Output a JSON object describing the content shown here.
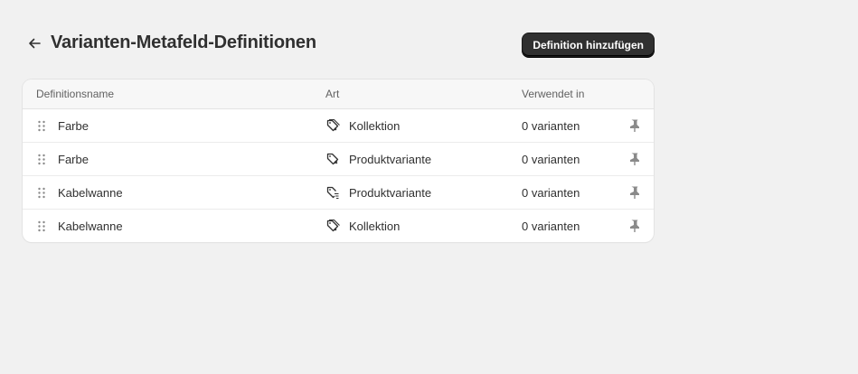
{
  "header": {
    "title": "Varianten-Metafeld-Definitionen",
    "back_icon": "arrow-left-icon",
    "add_button_label": "Definition hinzufügen"
  },
  "table": {
    "columns": [
      "Definitionsname",
      "Art",
      "Verwendet in"
    ],
    "rows": [
      {
        "name": "Farbe",
        "type": "Kollektion",
        "type_icon": "collection-icon",
        "used": "0 varianten"
      },
      {
        "name": "Farbe",
        "type": "Produktvariante",
        "type_icon": "product-variant-icon",
        "used": "0 varianten"
      },
      {
        "name": "Kabelwanne",
        "type": "Produktvariante",
        "type_icon": "product-variant-icon",
        "used": "0 varianten"
      },
      {
        "name": "Kabelwanne",
        "type": "Kollektion",
        "type_icon": "collection-icon",
        "used": "0 varianten"
      }
    ]
  },
  "colors": {
    "background": "#f1f1f1",
    "card": "#ffffff",
    "primary_button": "#303030",
    "text": "#303030",
    "muted_text": "#616161",
    "icon": "#8a8a8a"
  }
}
